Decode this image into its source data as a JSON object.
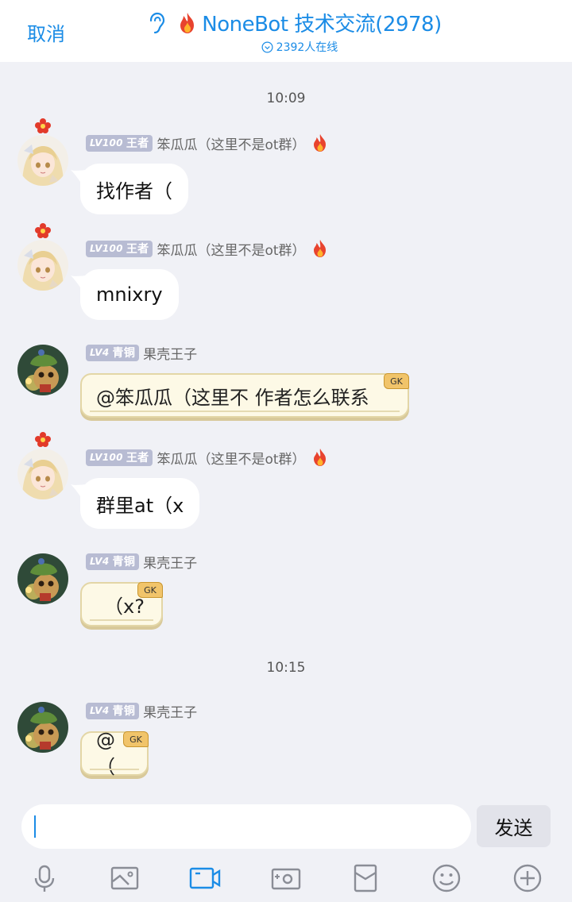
{
  "header": {
    "cancel_label": "取消",
    "group_name": "NoneBot 技术交流(2978)",
    "online_text": "2392人在线",
    "accent_color": "#1b8ce6"
  },
  "timestamps": [
    "10:09",
    "10:15"
  ],
  "users": {
    "benguagua": {
      "level": "LV100",
      "rank": "王者",
      "nickname": "笨瓜瓜（这里不是ot群）",
      "avatar_icon": "anime-girl-avatar",
      "title_icon": "fire-icon"
    },
    "guoke": {
      "level": "LV4",
      "rank": "青铜",
      "nickname": "果壳王子",
      "avatar_icon": "teemo-avatar"
    }
  },
  "messages": [
    {
      "sender": "笨瓜瓜（这里不是ot群）",
      "text": "找作者（",
      "style": "plain"
    },
    {
      "sender": "笨瓜瓜（这里不是ot群）",
      "text": "mnixry",
      "style": "plain"
    },
    {
      "sender": "果壳王子",
      "text": "@笨瓜瓜（这里不 作者怎么联系",
      "style": "gk",
      "tag": "GK"
    },
    {
      "sender": "笨瓜瓜（这里不是ot群）",
      "text": "群里at（x",
      "style": "plain"
    },
    {
      "sender": "果壳王子",
      "text": "（x?",
      "style": "gk",
      "tag": "GK"
    },
    {
      "sender": "果壳王子",
      "text": "@（",
      "style": "gk",
      "tag": "GK"
    }
  ],
  "composer": {
    "input_value": "",
    "send_label": "发送"
  },
  "toolbar_icons": [
    "microphone-icon",
    "image-icon",
    "video-icon",
    "camera-icon",
    "red-packet-icon",
    "emoji-icon",
    "plus-icon"
  ]
}
